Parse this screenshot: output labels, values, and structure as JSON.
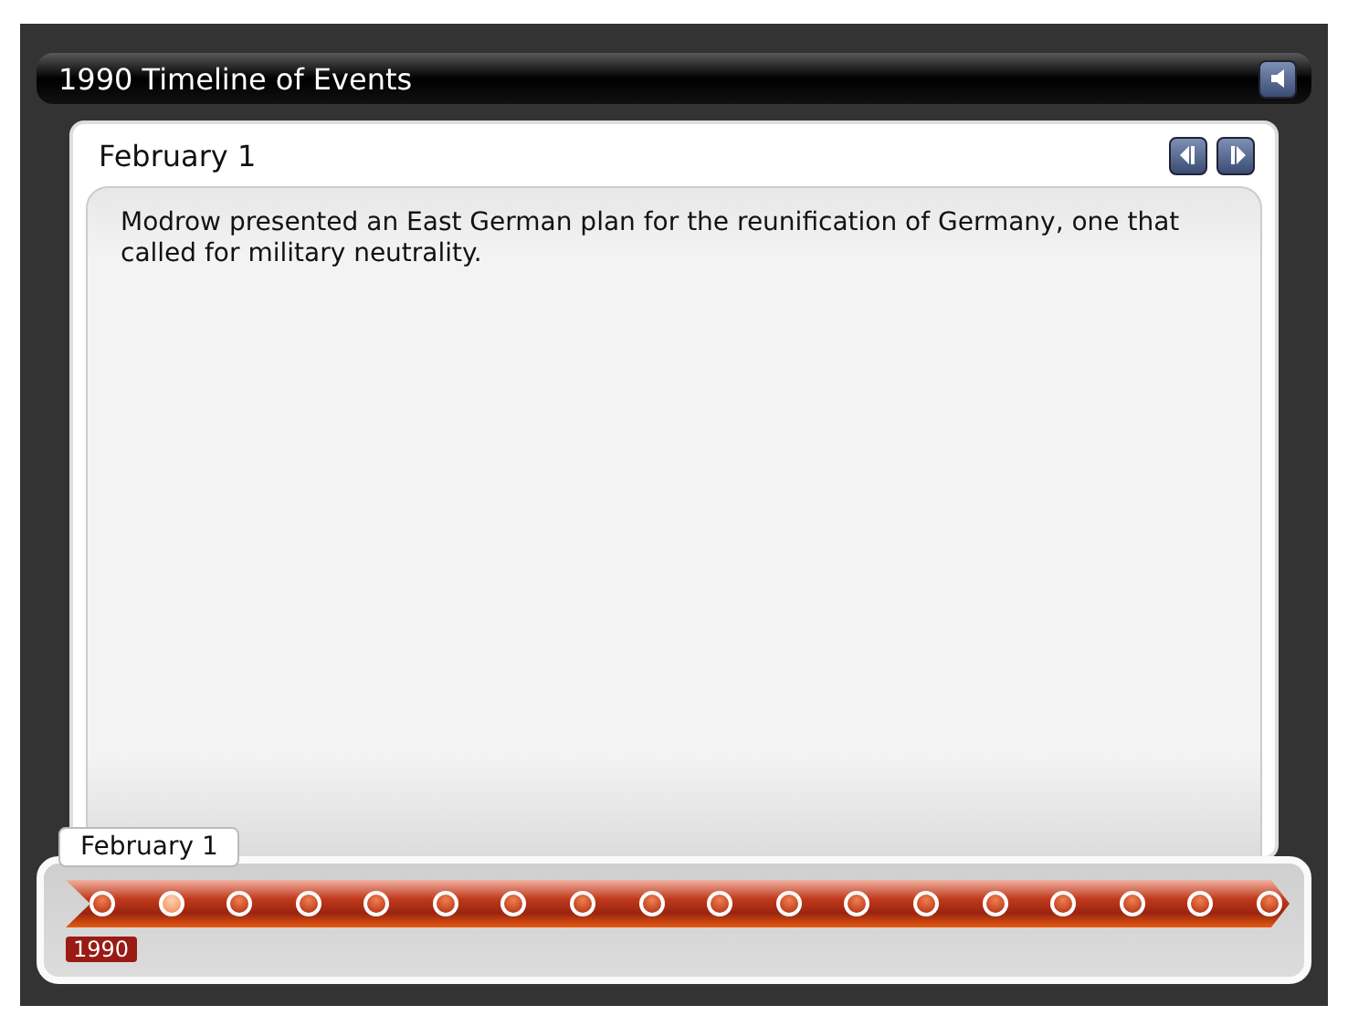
{
  "window": {
    "title": "1990 Timeline of Events"
  },
  "event": {
    "title": "February 1",
    "text": "Modrow presented an East German plan for the reunification of Germany, one that called for military neutrality."
  },
  "timeline": {
    "tooltip": "February 1",
    "year": "1990",
    "events": [
      {
        "selected": false
      },
      {
        "selected": true
      },
      {
        "selected": false
      },
      {
        "selected": false
      },
      {
        "selected": false
      },
      {
        "selected": false
      },
      {
        "selected": false
      },
      {
        "selected": false
      },
      {
        "selected": false
      },
      {
        "selected": false
      },
      {
        "selected": false
      },
      {
        "selected": false
      },
      {
        "selected": false
      },
      {
        "selected": false
      },
      {
        "selected": false
      },
      {
        "selected": false
      },
      {
        "selected": false
      },
      {
        "selected": false
      }
    ]
  }
}
